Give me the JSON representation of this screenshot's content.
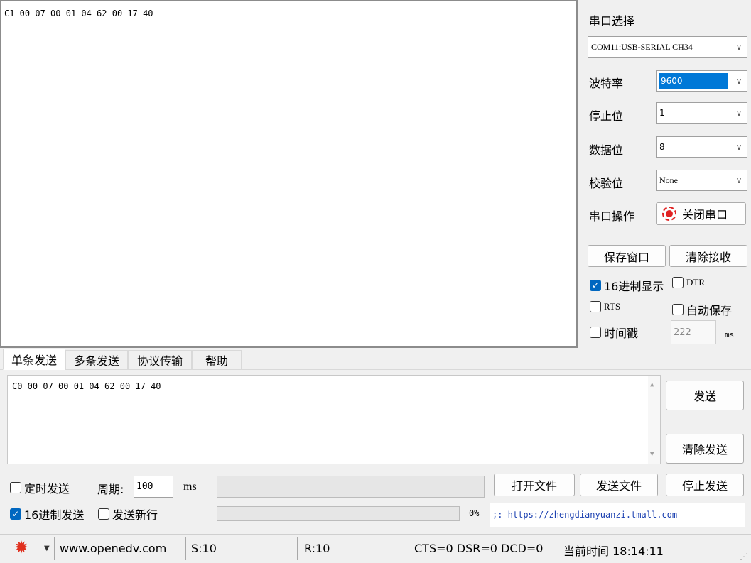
{
  "receive": {
    "text": "C1 00 07 00 01 04 62 00 17 40"
  },
  "port_panel": {
    "title": "串口选择",
    "port": "COM11:USB-SERIAL CH34",
    "baud_label": "波特率",
    "baud": "9600",
    "stop_label": "停止位",
    "stop": "1",
    "data_label": "数据位",
    "data_bits": "8",
    "parity_label": "校验位",
    "parity": "None",
    "op_label": "串口操作",
    "op_button": "关闭串口",
    "save_window": "保存窗口",
    "clear_receive": "清除接收",
    "hex_display": "16进制显示",
    "dtr": "DTR",
    "rts": "RTS",
    "auto_save": "自动保存",
    "timestamp": "时间戳",
    "timestamp_value": "222",
    "timestamp_unit": "ms"
  },
  "tabs": [
    "单条发送",
    "多条发送",
    "协议传输",
    "帮助"
  ],
  "send": {
    "text": "C0 00 07 00 01 04 62 00 17 40",
    "send_button": "发送",
    "clear_send_button": "清除发送",
    "timed_send": "定时发送",
    "period_label": "周期:",
    "period_value": "100",
    "period_unit": "ms",
    "open_file": "打开文件",
    "send_file": "发送文件",
    "stop_send": "停止发送",
    "hex_send": "16进制发送",
    "send_newline": "发送新行",
    "progress": "0%",
    "progress_value": 0,
    "link": ";: https://zhengdianyuanzi.tmall.com"
  },
  "status": {
    "site": "www.openedv.com",
    "sent": "S:10",
    "received": "R:10",
    "lines": "CTS=0 DSR=0 DCD=0",
    "time": "当前时间 18:14:11"
  },
  "icons": {
    "settings": "gear-icon",
    "record": "red-dot-icon"
  },
  "colors": {
    "accent": "#0067c0",
    "selection": "#0078d7",
    "gear": "#e0301e"
  }
}
